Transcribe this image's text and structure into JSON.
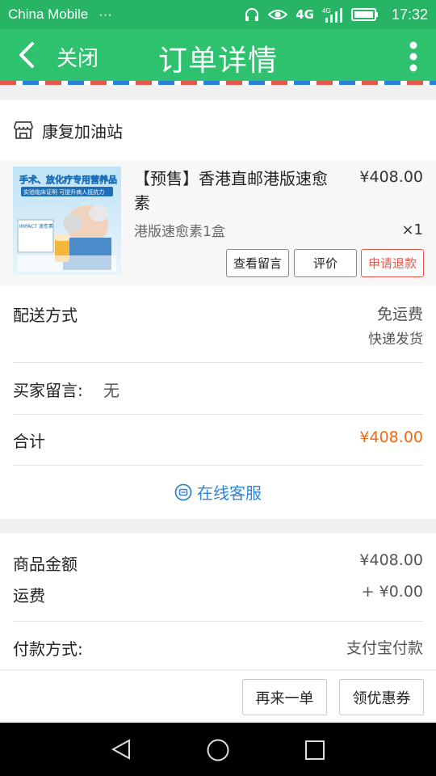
{
  "status_bar": {
    "carrier": "China Mobile",
    "carrier_extra": "···",
    "network": "4G",
    "time": "17:32"
  },
  "app_bar": {
    "close_label": "关闭",
    "title": "订单详情"
  },
  "store": {
    "name": "康复加油站"
  },
  "product": {
    "name": "【预售】香港直邮港版速愈素",
    "price": "¥408.00",
    "spec": "港版速愈素1盒",
    "quantity": "×1",
    "buttons": {
      "view_message": "查看留言",
      "review": "评价",
      "refund": "申请退款"
    },
    "image_text": {
      "headline": "手术、放化疗专用营养品",
      "subline": "实验临床证明 可提升病人抵抗力",
      "brand": "IMPACT 速愈素"
    }
  },
  "details": {
    "delivery_label": "配送方式",
    "delivery_value": "免运费",
    "delivery_sub": "快递发货",
    "buyer_message_label": "买家留言:",
    "buyer_message_value": "无",
    "total_label": "合计",
    "total_value": "¥408.00",
    "customer_service": "在线客服"
  },
  "summary": {
    "goods_amount_label": "商品金额",
    "goods_amount_value": "¥408.00",
    "shipping_label": "运费",
    "shipping_value": "+ ¥0.00",
    "payment_label": "付款方式:",
    "payment_value": "支付宝付款"
  },
  "footer": {
    "reorder": "再来一单",
    "coupon": "领优惠券"
  },
  "colors": {
    "header_green": "#2ec26f",
    "status_green": "#27b465",
    "accent_orange": "#ee6b12",
    "link_blue": "#2f86d6",
    "refund_red": "#e8574a"
  }
}
